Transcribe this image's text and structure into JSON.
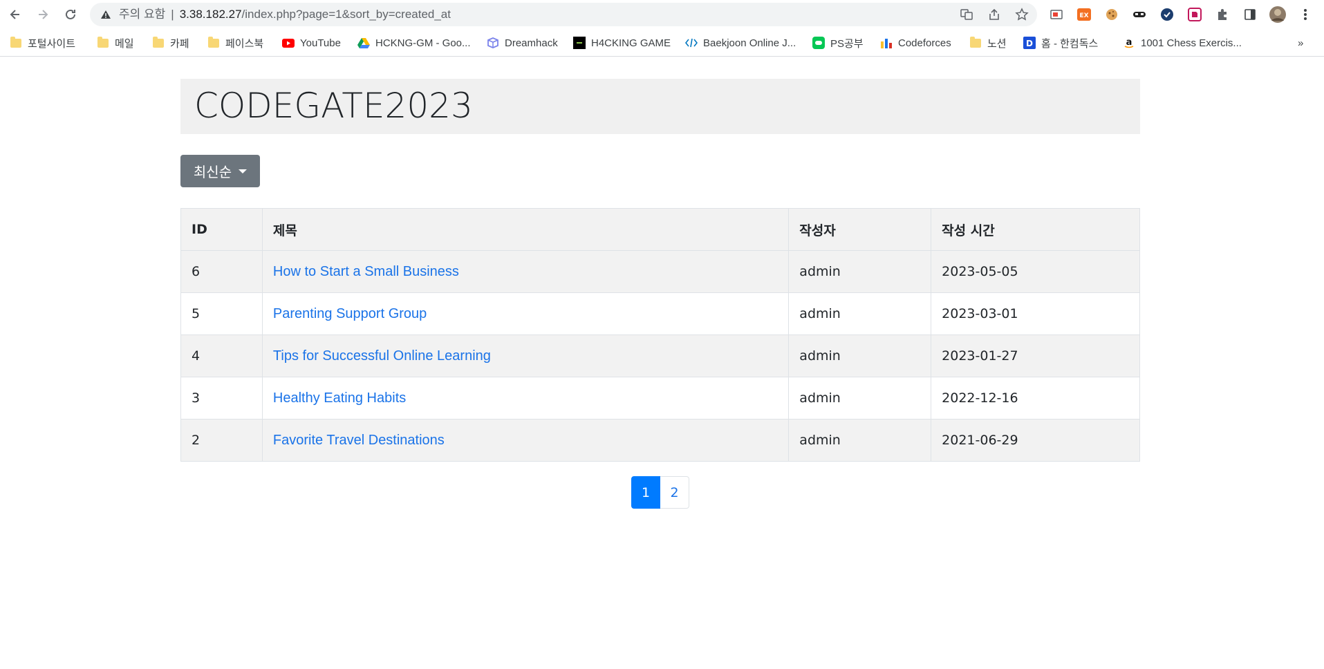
{
  "browser": {
    "omnibox": {
      "security_label": "주의 요함",
      "host": "3.38.182.27",
      "path": "/index.php?page=1&sort_by=created_at"
    },
    "bookmarks": [
      {
        "label": "포털사이트",
        "icon": "folder-icon"
      },
      {
        "label": "메일",
        "icon": "folder-icon"
      },
      {
        "label": "카페",
        "icon": "folder-icon"
      },
      {
        "label": "페이스북",
        "icon": "folder-icon"
      },
      {
        "label": "YouTube",
        "icon": "youtube-icon"
      },
      {
        "label": "HCKNG-GM - Goo...",
        "icon": "google-drive-icon"
      },
      {
        "label": "Dreamhack",
        "icon": "dreamhack-icon"
      },
      {
        "label": "H4CKING GAME",
        "icon": "h4cking-game-icon"
      },
      {
        "label": "Baekjoon Online J...",
        "icon": "code-brackets-icon"
      },
      {
        "label": "PS공부",
        "icon": "line-icon"
      },
      {
        "label": "Codeforces",
        "icon": "codeforces-icon"
      },
      {
        "label": "노션",
        "icon": "folder-icon"
      },
      {
        "label": "홈 - 한컴독스",
        "icon": "hancom-docs-icon"
      },
      {
        "label": "1001 Chess Exercis...",
        "icon": "amazon-icon"
      }
    ],
    "bookmarks_overflow": "»"
  },
  "page": {
    "title": "CODEGATE2023",
    "sort_button_label": "최신순",
    "table": {
      "headers": [
        "ID",
        "제목",
        "작성자",
        "작성 시간"
      ],
      "rows": [
        {
          "id": "6",
          "title": "How to Start a Small Business",
          "author": "admin",
          "created": "2023-05-05"
        },
        {
          "id": "5",
          "title": "Parenting Support Group",
          "author": "admin",
          "created": "2023-03-01"
        },
        {
          "id": "4",
          "title": "Tips for Successful Online Learning",
          "author": "admin",
          "created": "2023-01-27"
        },
        {
          "id": "3",
          "title": "Healthy Eating Habits",
          "author": "admin",
          "created": "2022-12-16"
        },
        {
          "id": "2",
          "title": "Favorite Travel Destinations",
          "author": "admin",
          "created": "2021-06-29"
        }
      ]
    },
    "pagination": {
      "pages": [
        "1",
        "2"
      ],
      "current": "1"
    }
  },
  "colors": {
    "accent": "#007bff",
    "link": "#1a73e8",
    "sort_button": "#6c757d",
    "jumbotron_bg": "#f0f0f0",
    "striped_row": "#f2f2f2"
  }
}
